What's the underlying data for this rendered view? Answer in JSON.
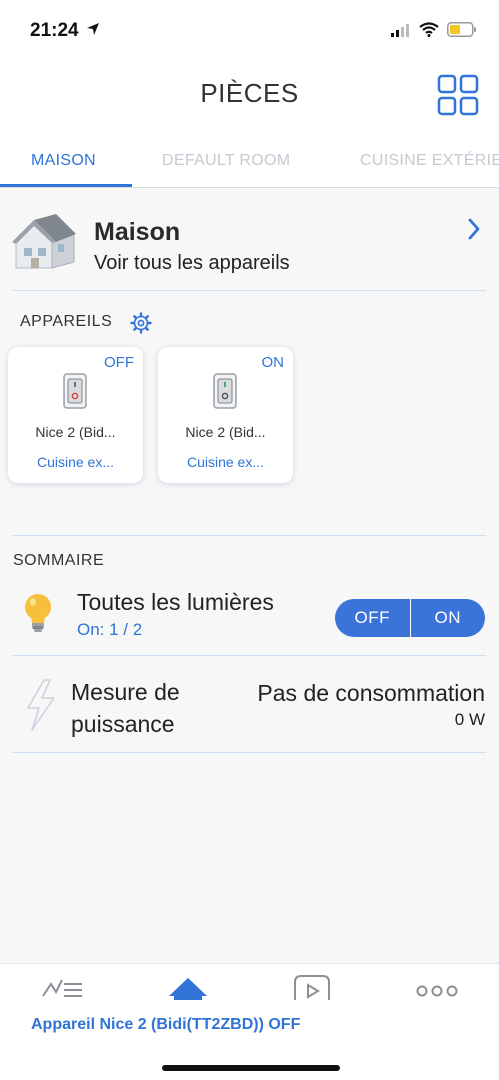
{
  "status_bar": {
    "time": "21:24"
  },
  "nav": {
    "title": "PIÈCES"
  },
  "tabs": [
    {
      "label": "MAISON"
    },
    {
      "label": "DEFAULT ROOM"
    },
    {
      "label": "CUISINE EXTÉRIE"
    }
  ],
  "room": {
    "name": "Maison",
    "subtitle": "Voir tous les appareils"
  },
  "devices_section": {
    "title": "APPAREILS"
  },
  "devices": [
    {
      "state": "OFF",
      "name": "Nice 2 (Bid...",
      "room": "Cuisine ex..."
    },
    {
      "state": "ON",
      "name": "Nice 2 (Bid...",
      "room": "Cuisine ex..."
    }
  ],
  "summary": {
    "title": "SOMMAIRE",
    "lights": {
      "label": "Toutes les lumières",
      "count": "On: 1 / 2",
      "off_label": "OFF",
      "on_label": "ON"
    },
    "power": {
      "label_line1": "Mesure de",
      "label_line2": "puissance",
      "value": "Pas de consommation",
      "watts": "0 W"
    }
  },
  "bottom": {
    "status": "Appareil Nice 2 (Bidi(TT2ZBD)) OFF"
  },
  "colors": {
    "accent": "#2f74d6",
    "toggle": "#3a74d8"
  }
}
